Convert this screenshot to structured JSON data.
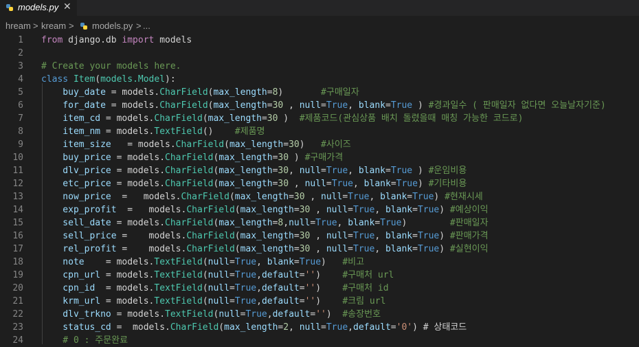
{
  "tab": {
    "filename": "models.py",
    "close": "✕",
    "icon": "python-icon"
  },
  "breadcrumb": [
    "hream",
    ">",
    "kream",
    ">",
    "models.py",
    ">",
    "..."
  ],
  "lines": [
    {
      "n": "1",
      "toks": [
        [
          "kw2",
          "from"
        ],
        [
          "pl",
          " django.db "
        ],
        [
          "kw2",
          "import"
        ],
        [
          "pl",
          " models"
        ]
      ]
    },
    {
      "n": "2",
      "toks": []
    },
    {
      "n": "3",
      "toks": [
        [
          "cm",
          "# Create your models here."
        ]
      ]
    },
    {
      "n": "4",
      "toks": [
        [
          "kw",
          "class"
        ],
        [
          "pl",
          " "
        ],
        [
          "mod",
          "Item"
        ],
        [
          "pl",
          "("
        ],
        [
          "mod",
          "models.Model"
        ],
        [
          "pl",
          "):"
        ]
      ]
    },
    {
      "n": "5",
      "toks": [
        [
          "pm",
          "    buy_date"
        ],
        [
          "pl",
          " = models."
        ],
        [
          "mod",
          "CharField"
        ],
        [
          "pl",
          "("
        ],
        [
          "pm",
          "max_length"
        ],
        [
          "pl",
          "="
        ],
        [
          "nm",
          "8"
        ],
        [
          "pl",
          ")       "
        ],
        [
          "cm",
          "#구매일자"
        ]
      ]
    },
    {
      "n": "6",
      "toks": [
        [
          "pm",
          "    for_date"
        ],
        [
          "pl",
          " = models."
        ],
        [
          "mod",
          "CharField"
        ],
        [
          "pl",
          "("
        ],
        [
          "pm",
          "max_length"
        ],
        [
          "pl",
          "="
        ],
        [
          "nm",
          "30"
        ],
        [
          "pl",
          " , "
        ],
        [
          "pm",
          "null"
        ],
        [
          "pl",
          "="
        ],
        [
          "kw",
          "True"
        ],
        [
          "pl",
          ", "
        ],
        [
          "pm",
          "blank"
        ],
        [
          "pl",
          "="
        ],
        [
          "kw",
          "True"
        ],
        [
          "pl",
          " ) "
        ],
        [
          "cm",
          "#경과일수 ( 판매일자 없다면 오늘날자기준)"
        ]
      ]
    },
    {
      "n": "7",
      "toks": [
        [
          "pm",
          "    item_cd"
        ],
        [
          "pl",
          " = models."
        ],
        [
          "mod",
          "CharField"
        ],
        [
          "pl",
          "("
        ],
        [
          "pm",
          "max_length"
        ],
        [
          "pl",
          "="
        ],
        [
          "nm",
          "30"
        ],
        [
          "pl",
          " )  "
        ],
        [
          "cm",
          "#제품코드(관심상품 배치 돌렸을때 매칭 가능한 코드로)"
        ]
      ]
    },
    {
      "n": "8",
      "toks": [
        [
          "pm",
          "    item_nm"
        ],
        [
          "pl",
          " = models."
        ],
        [
          "mod",
          "TextField"
        ],
        [
          "pl",
          "()    "
        ],
        [
          "cm",
          "#제품명"
        ]
      ]
    },
    {
      "n": "9",
      "toks": [
        [
          "pm",
          "    item_size"
        ],
        [
          "pl",
          "   = models."
        ],
        [
          "mod",
          "CharField"
        ],
        [
          "pl",
          "("
        ],
        [
          "pm",
          "max_length"
        ],
        [
          "pl",
          "="
        ],
        [
          "nm",
          "30"
        ],
        [
          "pl",
          ")   "
        ],
        [
          "cm",
          "#사이즈"
        ]
      ]
    },
    {
      "n": "10",
      "toks": [
        [
          "pm",
          "    buy_price"
        ],
        [
          "pl",
          " = models."
        ],
        [
          "mod",
          "CharField"
        ],
        [
          "pl",
          "("
        ],
        [
          "pm",
          "max_length"
        ],
        [
          "pl",
          "="
        ],
        [
          "nm",
          "30"
        ],
        [
          "pl",
          " ) "
        ],
        [
          "cm",
          "#구매가격"
        ]
      ]
    },
    {
      "n": "11",
      "toks": [
        [
          "pm",
          "    dlv_price"
        ],
        [
          "pl",
          " = models."
        ],
        [
          "mod",
          "CharField"
        ],
        [
          "pl",
          "("
        ],
        [
          "pm",
          "max_length"
        ],
        [
          "pl",
          "="
        ],
        [
          "nm",
          "30"
        ],
        [
          "pl",
          ", "
        ],
        [
          "pm",
          "null"
        ],
        [
          "pl",
          "="
        ],
        [
          "kw",
          "True"
        ],
        [
          "pl",
          ", "
        ],
        [
          "pm",
          "blank"
        ],
        [
          "pl",
          "="
        ],
        [
          "kw",
          "True"
        ],
        [
          "pl",
          " ) "
        ],
        [
          "cm",
          "#운임비용"
        ]
      ]
    },
    {
      "n": "12",
      "toks": [
        [
          "pm",
          "    etc_price"
        ],
        [
          "pl",
          " = models."
        ],
        [
          "mod",
          "CharField"
        ],
        [
          "pl",
          "("
        ],
        [
          "pm",
          "max_length"
        ],
        [
          "pl",
          "="
        ],
        [
          "nm",
          "30"
        ],
        [
          "pl",
          " , "
        ],
        [
          "pm",
          "null"
        ],
        [
          "pl",
          "="
        ],
        [
          "kw",
          "True"
        ],
        [
          "pl",
          ", "
        ],
        [
          "pm",
          "blank"
        ],
        [
          "pl",
          "="
        ],
        [
          "kw",
          "True"
        ],
        [
          "pl",
          ") "
        ],
        [
          "cm",
          "#기타비용"
        ]
      ]
    },
    {
      "n": "13",
      "toks": [
        [
          "pm",
          "    now_price"
        ],
        [
          "pl",
          "  =   models."
        ],
        [
          "mod",
          "CharField"
        ],
        [
          "pl",
          "("
        ],
        [
          "pm",
          "max_length"
        ],
        [
          "pl",
          "="
        ],
        [
          "nm",
          "30"
        ],
        [
          "pl",
          " , "
        ],
        [
          "pm",
          "null"
        ],
        [
          "pl",
          "="
        ],
        [
          "kw",
          "True"
        ],
        [
          "pl",
          ", "
        ],
        [
          "pm",
          "blank"
        ],
        [
          "pl",
          "="
        ],
        [
          "kw",
          "True"
        ],
        [
          "pl",
          ") "
        ],
        [
          "cm",
          "#현재시세"
        ]
      ]
    },
    {
      "n": "14",
      "toks": [
        [
          "pm",
          "    exp_profit"
        ],
        [
          "pl",
          "  =   models."
        ],
        [
          "mod",
          "CharField"
        ],
        [
          "pl",
          "("
        ],
        [
          "pm",
          "max_length"
        ],
        [
          "pl",
          "="
        ],
        [
          "nm",
          "30"
        ],
        [
          "pl",
          " , "
        ],
        [
          "pm",
          "null"
        ],
        [
          "pl",
          "="
        ],
        [
          "kw",
          "True"
        ],
        [
          "pl",
          ", "
        ],
        [
          "pm",
          "blank"
        ],
        [
          "pl",
          "="
        ],
        [
          "kw",
          "True"
        ],
        [
          "pl",
          ") "
        ],
        [
          "cm",
          "#예상이익"
        ]
      ]
    },
    {
      "n": "15",
      "toks": [
        [
          "pm",
          "    sell_date"
        ],
        [
          "pl",
          " = models."
        ],
        [
          "mod",
          "CharField"
        ],
        [
          "pl",
          "("
        ],
        [
          "pm",
          "max_length"
        ],
        [
          "pl",
          "="
        ],
        [
          "nm",
          "8"
        ],
        [
          "pl",
          ","
        ],
        [
          "pm",
          "null"
        ],
        [
          "pl",
          "="
        ],
        [
          "kw",
          "True"
        ],
        [
          "pl",
          ", "
        ],
        [
          "pm",
          "blank"
        ],
        [
          "pl",
          "="
        ],
        [
          "kw",
          "True"
        ],
        [
          "pl",
          ")        "
        ],
        [
          "cm",
          "#판매일자"
        ]
      ]
    },
    {
      "n": "16",
      "toks": [
        [
          "pm",
          "    sell_price"
        ],
        [
          "pl",
          " =    models."
        ],
        [
          "mod",
          "CharField"
        ],
        [
          "pl",
          "("
        ],
        [
          "pm",
          "max_length"
        ],
        [
          "pl",
          "="
        ],
        [
          "nm",
          "30"
        ],
        [
          "pl",
          " , "
        ],
        [
          "pm",
          "null"
        ],
        [
          "pl",
          "="
        ],
        [
          "kw",
          "True"
        ],
        [
          "pl",
          ", "
        ],
        [
          "pm",
          "blank"
        ],
        [
          "pl",
          "="
        ],
        [
          "kw",
          "True"
        ],
        [
          "pl",
          ") "
        ],
        [
          "cm",
          "#판매가격"
        ]
      ]
    },
    {
      "n": "17",
      "toks": [
        [
          "pm",
          "    rel_profit"
        ],
        [
          "pl",
          " =    models."
        ],
        [
          "mod",
          "CharField"
        ],
        [
          "pl",
          "("
        ],
        [
          "pm",
          "max_length"
        ],
        [
          "pl",
          "="
        ],
        [
          "nm",
          "30"
        ],
        [
          "pl",
          " , "
        ],
        [
          "pm",
          "null"
        ],
        [
          "pl",
          "="
        ],
        [
          "kw",
          "True"
        ],
        [
          "pl",
          ", "
        ],
        [
          "pm",
          "blank"
        ],
        [
          "pl",
          "="
        ],
        [
          "kw",
          "True"
        ],
        [
          "pl",
          ") "
        ],
        [
          "cm",
          "#실현이익"
        ]
      ]
    },
    {
      "n": "18",
      "toks": [
        [
          "pm",
          "    note"
        ],
        [
          "pl",
          "    = models."
        ],
        [
          "mod",
          "TextField"
        ],
        [
          "pl",
          "("
        ],
        [
          "pm",
          "null"
        ],
        [
          "pl",
          "="
        ],
        [
          "kw",
          "True"
        ],
        [
          "pl",
          ", "
        ],
        [
          "pm",
          "blank"
        ],
        [
          "pl",
          "="
        ],
        [
          "kw",
          "True"
        ],
        [
          "pl",
          ")   "
        ],
        [
          "cm",
          "#비고"
        ]
      ]
    },
    {
      "n": "19",
      "toks": [
        [
          "pm",
          "    cpn_url"
        ],
        [
          "pl",
          " = models."
        ],
        [
          "mod",
          "TextField"
        ],
        [
          "pl",
          "("
        ],
        [
          "pm",
          "null"
        ],
        [
          "pl",
          "="
        ],
        [
          "kw",
          "True"
        ],
        [
          "pl",
          ","
        ],
        [
          "pm",
          "default"
        ],
        [
          "pl",
          "="
        ],
        [
          "st",
          "''"
        ],
        [
          "pl",
          ")    "
        ],
        [
          "cm",
          "#구매처 url"
        ]
      ]
    },
    {
      "n": "20",
      "toks": [
        [
          "pm",
          "    cpn_id"
        ],
        [
          "pl",
          "  = models."
        ],
        [
          "mod",
          "TextField"
        ],
        [
          "pl",
          "("
        ],
        [
          "pm",
          "null"
        ],
        [
          "pl",
          "="
        ],
        [
          "kw",
          "True"
        ],
        [
          "pl",
          ","
        ],
        [
          "pm",
          "default"
        ],
        [
          "pl",
          "="
        ],
        [
          "st",
          "''"
        ],
        [
          "pl",
          ")    "
        ],
        [
          "cm",
          "#구매처 id"
        ]
      ]
    },
    {
      "n": "21",
      "toks": [
        [
          "pm",
          "    krm_url"
        ],
        [
          "pl",
          " = models."
        ],
        [
          "mod",
          "TextField"
        ],
        [
          "pl",
          "("
        ],
        [
          "pm",
          "null"
        ],
        [
          "pl",
          "="
        ],
        [
          "kw",
          "True"
        ],
        [
          "pl",
          ","
        ],
        [
          "pm",
          "default"
        ],
        [
          "pl",
          "="
        ],
        [
          "st",
          "''"
        ],
        [
          "pl",
          ")    "
        ],
        [
          "cm",
          "#크림 url"
        ]
      ]
    },
    {
      "n": "22",
      "toks": [
        [
          "pm",
          "    dlv_trkno"
        ],
        [
          "pl",
          " = models."
        ],
        [
          "mod",
          "TextField"
        ],
        [
          "pl",
          "("
        ],
        [
          "pm",
          "null"
        ],
        [
          "pl",
          "="
        ],
        [
          "kw",
          "True"
        ],
        [
          "pl",
          ","
        ],
        [
          "pm",
          "default"
        ],
        [
          "pl",
          "="
        ],
        [
          "st",
          "''"
        ],
        [
          "pl",
          ")  "
        ],
        [
          "cm",
          "#송장번호"
        ]
      ]
    },
    {
      "n": "23",
      "toks": [
        [
          "pm",
          "    status_cd"
        ],
        [
          "pl",
          " =  models."
        ],
        [
          "mod",
          "CharField"
        ],
        [
          "pl",
          "("
        ],
        [
          "pm",
          "max_length"
        ],
        [
          "pl",
          "="
        ],
        [
          "nm",
          "2"
        ],
        [
          "pl",
          ", "
        ],
        [
          "pm",
          "null"
        ],
        [
          "pl",
          "="
        ],
        [
          "kw",
          "True"
        ],
        [
          "pl",
          ","
        ],
        [
          "pm",
          "default"
        ],
        [
          "pl",
          "="
        ],
        [
          "st",
          "'0'"
        ],
        [
          "pl",
          ") # 상태코드"
        ]
      ]
    },
    {
      "n": "24",
      "toks": [
        [
          "cm",
          "    # 0 : 주문완료"
        ]
      ]
    }
  ]
}
